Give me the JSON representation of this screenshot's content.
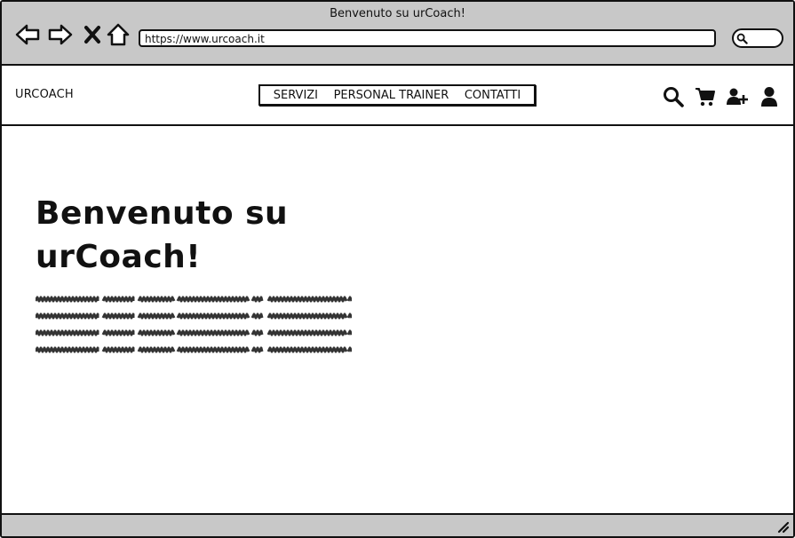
{
  "window": {
    "title": "Benvenuto su urCoach!",
    "url": "https://www.urcoach.it"
  },
  "toolbar": {
    "buttons": [
      "back-icon",
      "forward-icon",
      "close-icon",
      "home-icon"
    ],
    "search_icon": "search-icon"
  },
  "site": {
    "logo": "URCOACH",
    "menu": [
      {
        "label": "SERVIZI"
      },
      {
        "label": "PERSONAL TRAINER"
      },
      {
        "label": "CONTATTI"
      }
    ],
    "header_icons": [
      "search-icon",
      "cart-icon",
      "add-user-icon",
      "user-icon"
    ]
  },
  "hero": {
    "title": "Benvenuto su urCoach!"
  },
  "colors": {
    "chrome": "#c8c8c8",
    "ink": "#111111",
    "background": "#ffffff"
  }
}
